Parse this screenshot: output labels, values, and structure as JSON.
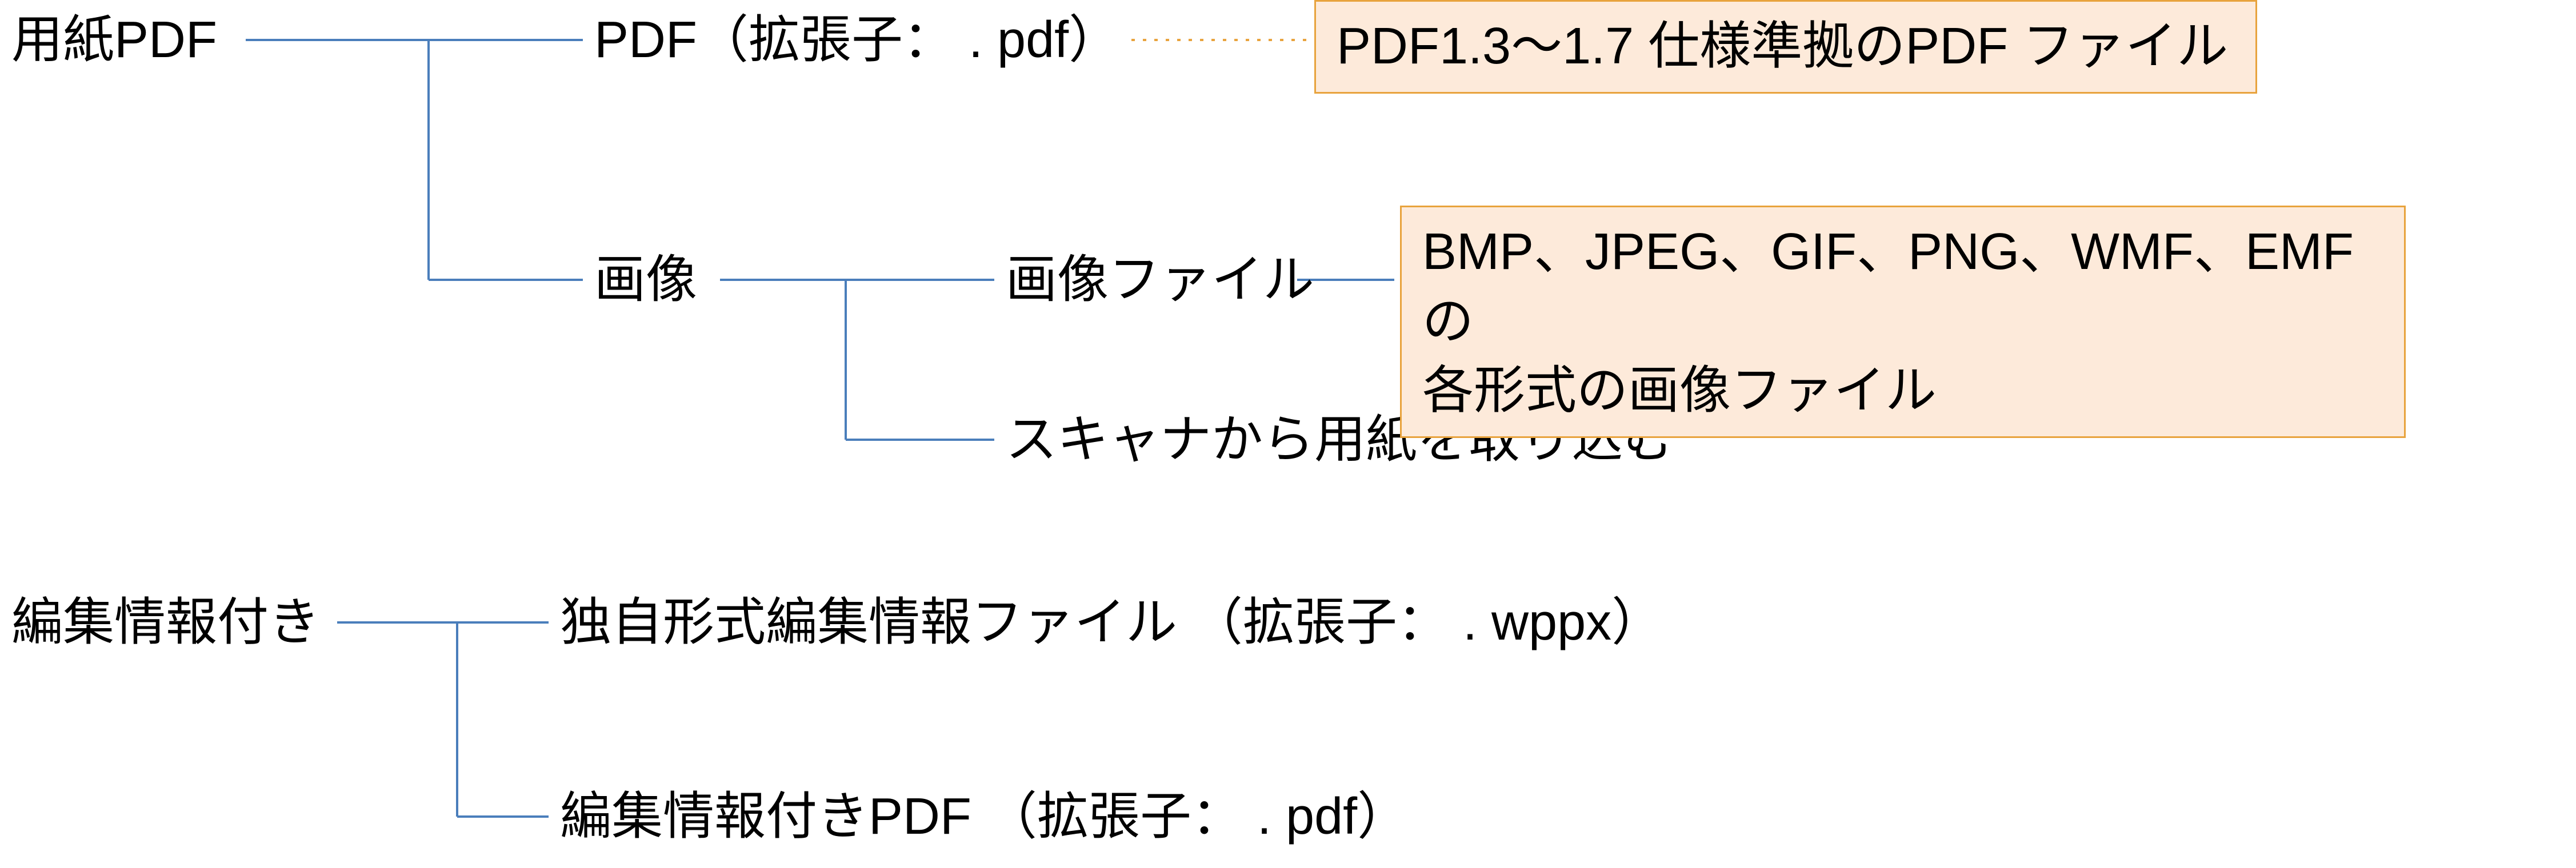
{
  "tree": {
    "root1": {
      "label": "用紙PDF",
      "children": {
        "pdf": {
          "label": "PDF（拡張子： . pdf）",
          "note": "PDF1.3～1.7 仕様準拠のPDF ファイル"
        },
        "image": {
          "label": "画像",
          "children": {
            "imageFile": {
              "label": "画像ファイル",
              "note": "BMP、JPEG、GIF、PNG、WMF、EMF の\n各形式の画像ファイル"
            },
            "scanner": {
              "label": "スキャナから用紙を取り込む"
            }
          }
        }
      }
    },
    "root2": {
      "label": "編集情報付き",
      "children": {
        "wppx": {
          "label": "独自形式編集情報ファイル （拡張子： . wppx）"
        },
        "editPdf": {
          "label": "編集情報付きPDF （拡張子： . pdf）"
        }
      }
    }
  }
}
